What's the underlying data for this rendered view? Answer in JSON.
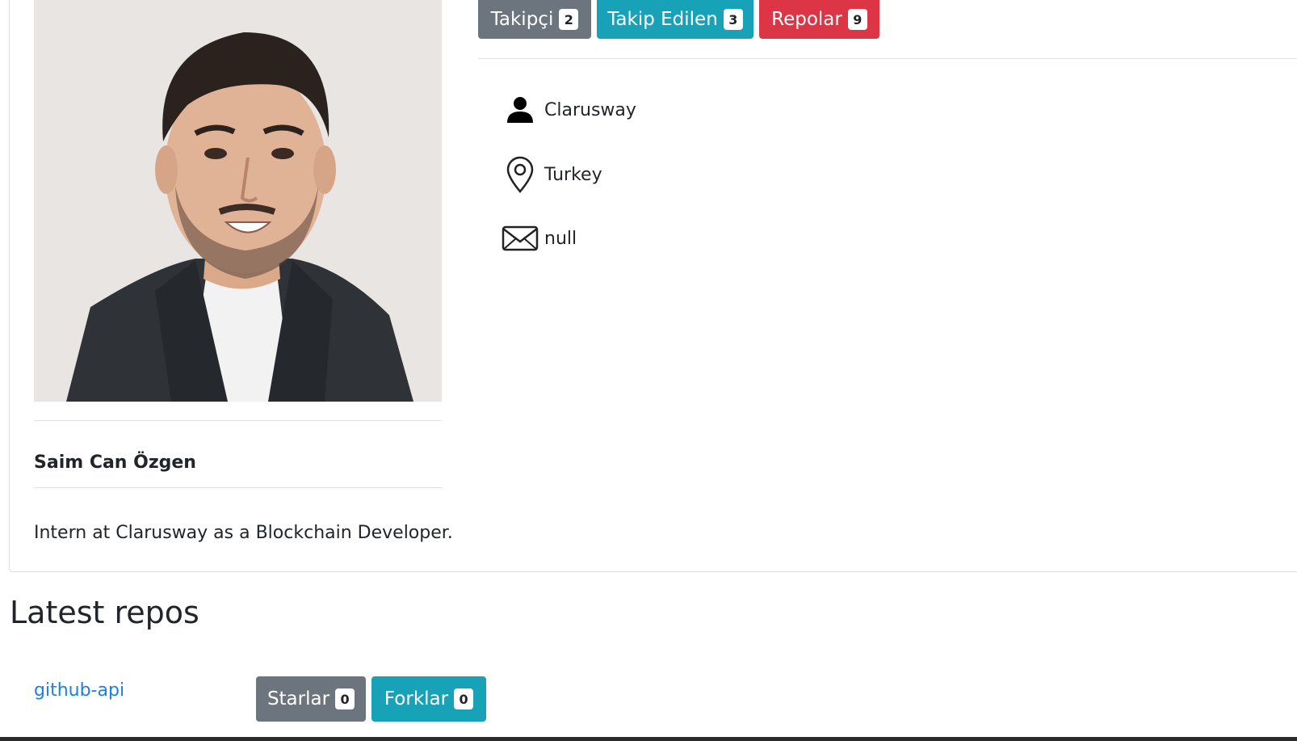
{
  "profile": {
    "name": "Saim Can Özgen",
    "bio": "Intern at Clarusway as a Blockchain Developer."
  },
  "stats": [
    {
      "label": "Takipçi",
      "count": "2",
      "color": "#6c757d"
    },
    {
      "label": "Takip Edilen",
      "count": "3",
      "color": "#17a2b8"
    },
    {
      "label": "Repolar",
      "count": "9",
      "color": "#dc3545"
    }
  ],
  "info": {
    "company": "Clarusway",
    "location": "Turkey",
    "email": "null",
    "company_icon": "person-icon",
    "location_icon": "location-pin-icon",
    "email_icon": "envelope-icon"
  },
  "latest_repos": {
    "title": "Latest repos",
    "items": [
      {
        "name": "github-api",
        "stars_label": "Starlar",
        "stars": "0",
        "forks_label": "Forklar",
        "forks": "0"
      }
    ]
  },
  "colors": {
    "link": "#1a7fe6",
    "gray": "#6c757d",
    "teal": "#17a2b8",
    "red": "#dc3545"
  }
}
